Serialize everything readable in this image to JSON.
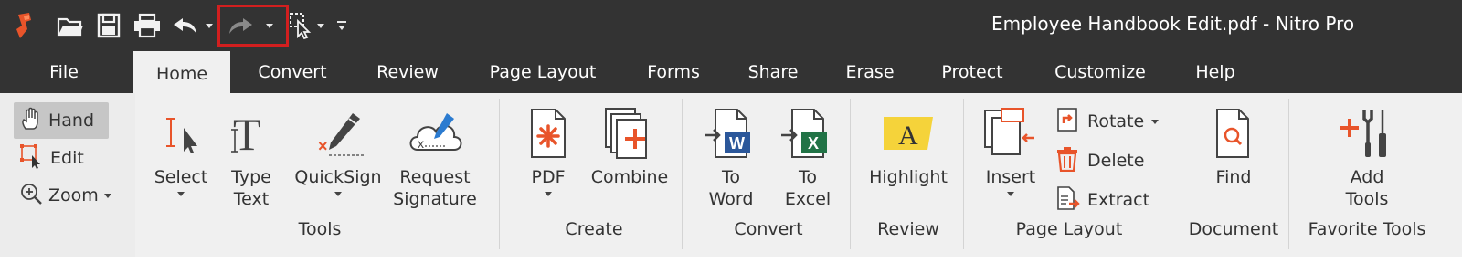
{
  "window": {
    "title": "Employee Handbook Edit.pdf - Nitro Pro"
  },
  "quick_access": [
    {
      "name": "app-logo-icon"
    },
    {
      "name": "open-folder-icon"
    },
    {
      "name": "save-icon"
    },
    {
      "name": "print-icon"
    },
    {
      "name": "undo-icon"
    },
    {
      "name": "redo-icon"
    },
    {
      "name": "select-cursor-icon"
    },
    {
      "name": "customize-toolbar-icon"
    }
  ],
  "tabs": [
    {
      "label": "File"
    },
    {
      "label": "Home",
      "active": true
    },
    {
      "label": "Convert"
    },
    {
      "label": "Review"
    },
    {
      "label": "Page Layout"
    },
    {
      "label": "Forms"
    },
    {
      "label": "Share"
    },
    {
      "label": "Erase"
    },
    {
      "label": "Protect"
    },
    {
      "label": "Customize"
    },
    {
      "label": "Help"
    }
  ],
  "left_panel": {
    "hand": "Hand",
    "edit": "Edit",
    "zoom": "Zoom"
  },
  "groups": {
    "tools": {
      "label": "Tools",
      "select": "Select",
      "type_text_1": "Type",
      "type_text_2": "Text",
      "quicksign": "QuickSign",
      "request_1": "Request",
      "request_2": "Signature"
    },
    "create": {
      "label": "Create",
      "pdf": "PDF",
      "combine": "Combine"
    },
    "convert": {
      "label": "Convert",
      "to_word_1": "To",
      "to_word_2": "Word",
      "to_excel_1": "To",
      "to_excel_2": "Excel"
    },
    "review": {
      "label": "Review",
      "highlight": "Highlight"
    },
    "page_layout": {
      "label": "Page Layout",
      "insert": "Insert",
      "rotate": "Rotate",
      "delete": "Delete",
      "extract": "Extract"
    },
    "document": {
      "label": "Document",
      "find": "Find"
    },
    "favorite": {
      "label": "Favorite Tools",
      "add_1": "Add",
      "add_2": "Tools"
    }
  },
  "colors": {
    "accent": "#e8542a",
    "titlebar": "#333333",
    "ribbon": "#f0f0f0",
    "word_blue": "#2b579a",
    "excel_green": "#217346",
    "highlight_yellow": "#f5d33a",
    "annotation_red": "#d21f1f"
  }
}
